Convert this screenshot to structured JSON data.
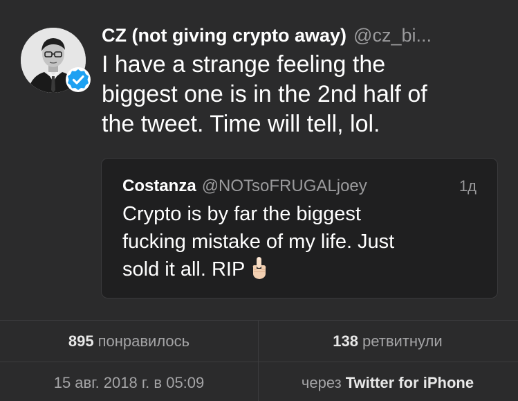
{
  "tweet": {
    "display_name": "CZ (not giving crypto away)",
    "handle": "@cz_bi...",
    "text": "I have a strange feeling the\nbiggest one is in the 2nd half of\nthe tweet.  Time will tell, lol."
  },
  "quoted_tweet": {
    "display_name": "Costanza",
    "handle": "@NOTsoFRUGALjoey",
    "time": "1д",
    "text": "Crypto is by far the biggest\nfucking mistake of my life. Just\nsold it all. RIP"
  },
  "stats": {
    "likes_count": "895",
    "likes_label": "понравилось",
    "retweets_count": "138",
    "retweets_label": "ретвитнули"
  },
  "meta": {
    "timestamp": "15 авг. 2018 г. в 05:09",
    "via_label": "через",
    "app_name": "Twitter for iPhone"
  },
  "icons": {
    "verified": "verified-badge-icon",
    "emoji": "middle-finger-emoji"
  },
  "colors": {
    "background": "#2b2b2c",
    "card_background": "#1f1f20",
    "verified_blue": "#1da1f2",
    "secondary_text": "#9a9a9c"
  }
}
